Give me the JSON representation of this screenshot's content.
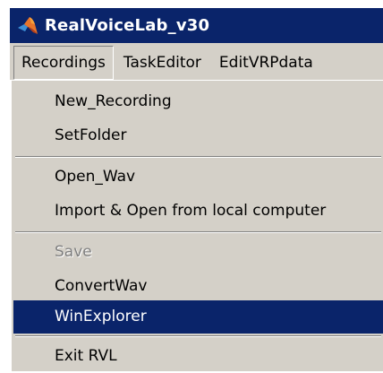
{
  "window": {
    "title": "RealVoiceLab_v30",
    "icon": "matlab-logo-icon"
  },
  "menubar": {
    "items": [
      {
        "label": "Recordings",
        "active": true
      },
      {
        "label": "TaskEditor",
        "active": false
      },
      {
        "label": "EditVRPdata",
        "active": false
      }
    ]
  },
  "recordings_menu": {
    "items": [
      {
        "label": "New_Recording",
        "enabled": true
      },
      {
        "label": "SetFolder",
        "enabled": true
      },
      {
        "label": "Open_Wav",
        "enabled": true
      },
      {
        "label": "Import & Open from local computer",
        "enabled": true
      },
      {
        "label": "Save",
        "enabled": false
      },
      {
        "label": "ConvertWav",
        "enabled": true
      },
      {
        "label": "WinExplorer",
        "enabled": true,
        "highlighted": true
      },
      {
        "label": "Exit RVL",
        "enabled": true
      }
    ]
  },
  "colors": {
    "titlebar": "#0a246a",
    "menu_background": "#d4d0c8",
    "highlight": "#0a246a",
    "disabled_text": "#808080"
  }
}
